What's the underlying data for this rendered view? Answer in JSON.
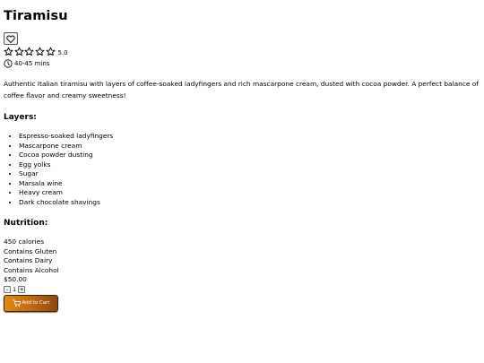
{
  "recipe": {
    "title": "Tiramisu",
    "rating": "5.0",
    "time": "40-45 mins",
    "description": "Authentic Italian tiramisu with layers of coffee-soaked ladyfingers and rich mascarpone cream, dusted with cocoa powder. A perfect balance of coffee flavor and creamy sweetness!",
    "layers_heading": "Layers:",
    "layers": [
      "Espresso-soaked ladyfingers",
      "Mascarpone cream",
      "Cocoa powder dusting",
      "Egg yolks",
      "Sugar",
      "Marsala wine",
      "Heavy cream",
      "Dark chocolate shavings"
    ],
    "nutrition_heading": "Nutrition:",
    "nutrition": [
      "450 calories",
      "Contains Gluten",
      "Contains Dairy",
      "Contains Alcohol"
    ],
    "price": "$50.00"
  },
  "cart": {
    "decrement_label": "-",
    "quantity": "1",
    "increment_label": "+",
    "add_label": "Add to Cart"
  },
  "icons": {
    "favorite": "heart-icon",
    "star": "star-outline-icon",
    "time": "clock-icon",
    "cart": "cart-icon"
  },
  "colors": {
    "cart_button_start": "#e58a12",
    "cart_button_end": "#8a4710"
  }
}
